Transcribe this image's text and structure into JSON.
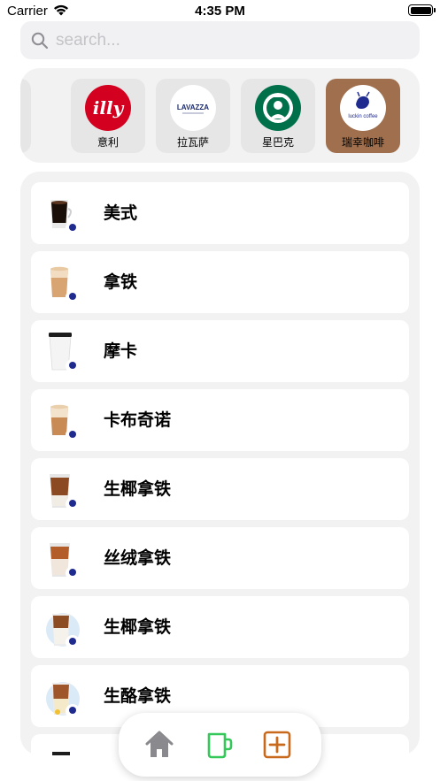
{
  "status": {
    "carrier": "Carrier",
    "time": "4:35 PM"
  },
  "search": {
    "placeholder": "search..."
  },
  "brands": [
    {
      "name": "意利",
      "logo": "illy-logo"
    },
    {
      "name": "拉瓦萨",
      "logo": "lavazza-logo"
    },
    {
      "name": "星巴克",
      "logo": "starbucks-logo"
    },
    {
      "name": "瑞幸咖啡",
      "logo": "luckin-coffee-logo",
      "selected": true
    }
  ],
  "brand_logo_texts": {
    "illy": "illy",
    "lavazza": "LAVAZZA",
    "luckin": "luckin coffee"
  },
  "products": [
    {
      "name": "美式",
      "icon": "coffee-cup-icon"
    },
    {
      "name": "拿铁",
      "icon": "coffee-cup-icon"
    },
    {
      "name": "摩卡",
      "icon": "coffee-cup-icon"
    },
    {
      "name": "卡布奇诺",
      "icon": "coffee-cup-icon"
    },
    {
      "name": "生椰拿铁",
      "icon": "coffee-cup-icon"
    },
    {
      "name": "丝绒拿铁",
      "icon": "coffee-cup-icon"
    },
    {
      "name": "生椰拿铁",
      "icon": "coffee-cup-icon"
    },
    {
      "name": "生酪拿铁",
      "icon": "coffee-cup-icon"
    }
  ],
  "tabbar": {
    "items": [
      {
        "name": "home",
        "icon": "home-icon"
      },
      {
        "name": "coffee",
        "icon": "mug-icon"
      },
      {
        "name": "add",
        "icon": "add-square-icon"
      }
    ]
  },
  "colors": {
    "selected_brand": "#a0704e",
    "home_icon": "#8a8a8e",
    "mug_icon": "#34c759",
    "add_icon": "#c8691c",
    "panel_bg": "#f2f2f2",
    "search_bg": "#f1f1f4"
  }
}
